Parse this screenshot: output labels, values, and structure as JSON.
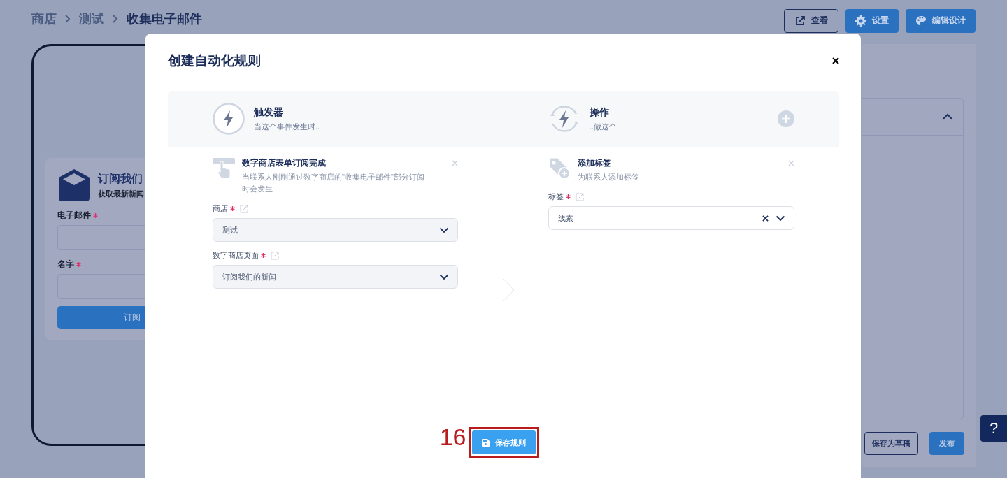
{
  "breadcrumb": [
    "商店",
    "测试",
    "收集电子邮件"
  ],
  "header_buttons": [
    {
      "label": "查看",
      "kind": "outline"
    },
    {
      "label": "设置",
      "kind": "primary"
    },
    {
      "label": "编辑设计",
      "kind": "primary"
    }
  ],
  "preview": {
    "title": "订阅我们",
    "subtitle": "获取最新新闻",
    "fields": [
      {
        "label": "电子邮件",
        "required": true
      },
      {
        "label": "名字",
        "required": true
      }
    ],
    "button": "订阅"
  },
  "editor": {
    "expanded": true,
    "buttons": [
      {
        "label": "保存为草稿",
        "kind": "outline"
      },
      {
        "label": "发布",
        "kind": "primary"
      }
    ]
  },
  "help_button": "?",
  "dialog": {
    "title": "创建自动化规则",
    "trigger": {
      "heading": "触发器",
      "subheading": "当这个事件发生时..",
      "item": {
        "title": "数字商店表单订阅完成",
        "description": "当联系人刚刚通过数字商店的\"收集电子邮件\"部分订阅时会发生",
        "fields": [
          {
            "label": "商店",
            "required": true,
            "value": "测试",
            "disabled": true,
            "clearable": false
          },
          {
            "label": "数字商店页面",
            "required": true,
            "value": "订阅我们的新闻",
            "disabled": true,
            "clearable": false
          }
        ]
      }
    },
    "action": {
      "heading": "操作",
      "subheading": "..做这个",
      "item": {
        "title": "添加标签",
        "description": "为联系人添加标签",
        "fields": [
          {
            "label": "标签",
            "required": true,
            "value": "线索",
            "disabled": false,
            "clearable": true
          }
        ]
      }
    },
    "save_button": "保存规则",
    "annotation": "16"
  }
}
